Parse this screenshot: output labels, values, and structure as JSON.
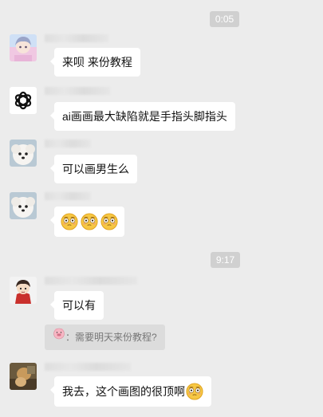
{
  "timestamps": [
    "0:05",
    "9:17"
  ],
  "messages": [
    {
      "text": "来呗 来份教程",
      "avatar_icon": "anime-girl-avatar-icon"
    },
    {
      "text": "ai画画最大缺陷就是手指头脚指头",
      "avatar_icon": "openai-logo-avatar-icon"
    },
    {
      "text": "可以画男生么",
      "avatar_icon": "white-dog-avatar-icon"
    },
    {
      "text": "",
      "avatar_icon": "white-dog-avatar-icon",
      "emoji_count": 3,
      "emoji_icon": "flushed-face-emoji-icon"
    },
    {
      "text": "可以有",
      "avatar_icon": "cartoon-character-avatar-icon"
    },
    {
      "text": "我去，这个画图的很顶啊",
      "avatar_icon": "photo-avatar-icon",
      "emoji_icon": "flushed-face-emoji-icon"
    }
  ],
  "quote": {
    "icon": "pig-face-icon",
    "text": "：需要明天来份教程?"
  },
  "colors": {
    "background": "#ececec",
    "bubble": "#ffffff",
    "timestamp_bg": "#d0d0d0",
    "quote_bg": "#dcdcdc"
  }
}
